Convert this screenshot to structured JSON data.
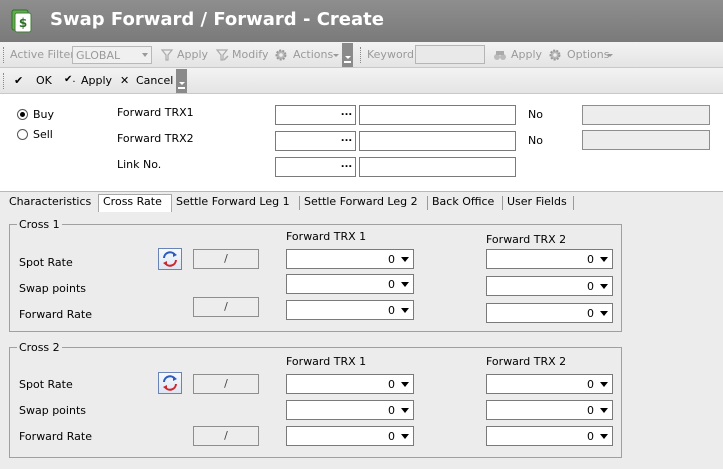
{
  "window": {
    "title": "Swap Forward / Forward - Create"
  },
  "toolbar1": {
    "active_filter_label": "Active Filter",
    "filter_value": "GLOBAL",
    "apply_label": "Apply",
    "modify_label": "Modify",
    "actions_label": "Actions",
    "keyword_label": "Keyword",
    "keyword_value": "",
    "keyword_apply_label": "Apply",
    "options_label": "Options"
  },
  "toolbar2": {
    "ok_label": "OK",
    "apply_label": "Apply",
    "cancel_label": "Cancel"
  },
  "header": {
    "buy_label": "Buy",
    "sell_label": "Sell",
    "selected_side": "Buy",
    "forward_trx1_label": "Forward TRX1",
    "forward_trx2_label": "Forward TRX2",
    "link_no_label": "Link No.",
    "no_label_1": "No",
    "no_label_2": "No",
    "ellipsis": "...",
    "forward_trx1_id": "",
    "forward_trx1_desc": "",
    "forward_trx2_id": "",
    "forward_trx2_desc": "",
    "link_no_id": "",
    "link_no_desc": "",
    "no_value_1": "",
    "no_value_2": ""
  },
  "tabs": [
    {
      "label": "Characteristics",
      "active": false
    },
    {
      "label": "Cross Rate",
      "active": true
    },
    {
      "label": "Settle Forward Leg 1",
      "active": false
    },
    {
      "label": "Settle Forward Leg 2",
      "active": false
    },
    {
      "label": "Back Office",
      "active": false
    },
    {
      "label": "User Fields",
      "active": false
    }
  ],
  "cross1": {
    "title": "Cross 1",
    "col1_header": "Forward TRX 1",
    "col2_header": "Forward TRX 2",
    "spot_rate_label": "Spot Rate",
    "swap_points_label": "Swap points",
    "forward_rate_label": "Forward Rate",
    "spot_rate_pair": "/",
    "forward_rate_pair": "/",
    "trx1": {
      "spot": "0",
      "swap": "0",
      "forward": "0"
    },
    "trx2": {
      "spot": "0",
      "swap": "0",
      "forward": "0"
    }
  },
  "cross2": {
    "title": "Cross 2",
    "col1_header": "Forward TRX 1",
    "col2_header": "Forward TRX 2",
    "spot_rate_label": "Spot Rate",
    "swap_points_label": "Swap points",
    "forward_rate_label": "Forward Rate",
    "spot_rate_pair": "/",
    "forward_rate_pair": "/",
    "trx1": {
      "spot": "0",
      "swap": "0",
      "forward": "0"
    },
    "trx2": {
      "spot": "0",
      "swap": "0",
      "forward": "0"
    }
  },
  "icons": {
    "app": "swap-document-icon",
    "swap": "swap-arrows-icon",
    "gear": "gear-icon",
    "binoculars": "binoculars-icon",
    "filter": "filter-icon"
  },
  "colors": {
    "titlebar": "#8a8a8a",
    "panel": "#ececec",
    "accent": "#2c5bbd",
    "swap_red": "#d0242a"
  }
}
